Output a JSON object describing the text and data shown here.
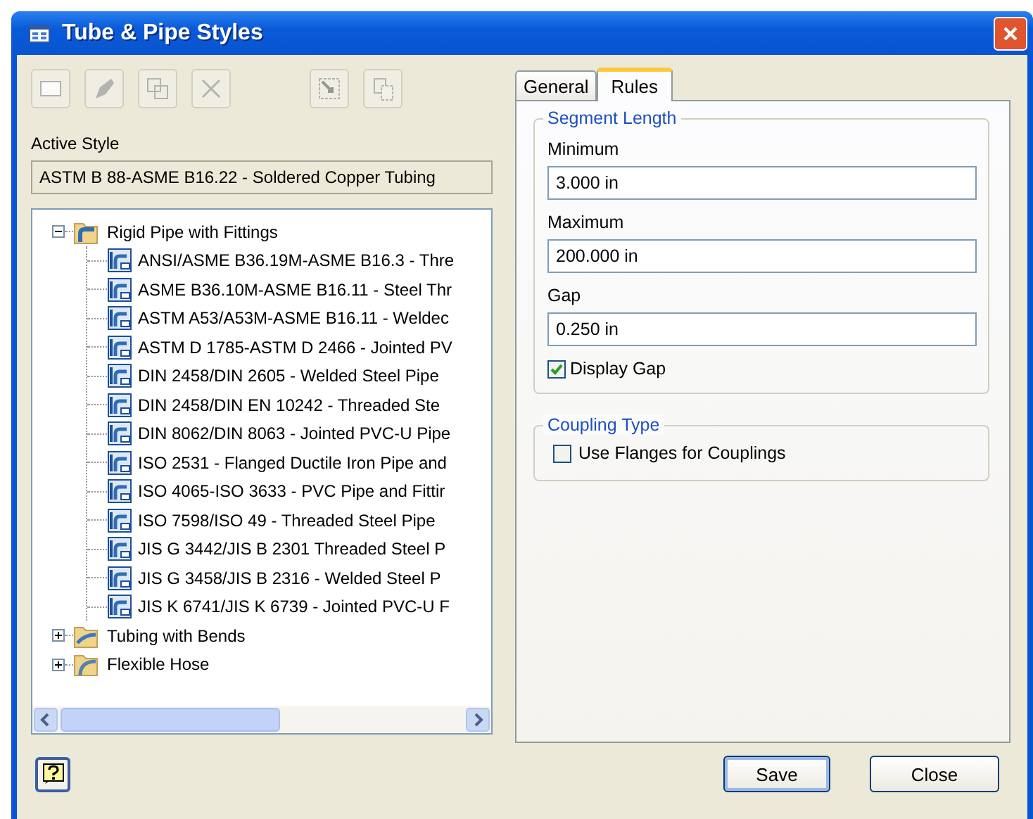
{
  "window": {
    "title": "Tube & Pipe Styles"
  },
  "toolbar": [
    {
      "kind": "new",
      "disabled": true
    },
    {
      "kind": "edit",
      "disabled": true
    },
    {
      "kind": "copy",
      "disabled": true
    },
    {
      "kind": "delete",
      "disabled": true
    },
    {
      "kind": "import",
      "disabled": true
    },
    {
      "kind": "export",
      "disabled": true
    }
  ],
  "active_style": {
    "label": "Active Style",
    "value": "ASTM B 88-ASME B16.22 - Soldered Copper Tubing"
  },
  "style_tree": [
    {
      "label": "Rigid Pipe with Fittings",
      "kind": "rigid",
      "expanded": true,
      "children": [
        {
          "label": "ANSI/ASME B36.19M-ASME B16.3 - Thre"
        },
        {
          "label": "ASME B36.10M-ASME B16.11 - Steel Thr"
        },
        {
          "label": "ASTM A53/A53M-ASME B16.11 - Weldec"
        },
        {
          "label": "ASTM D 1785-ASTM D 2466 - Jointed PV"
        },
        {
          "label": "DIN 2458/DIN 2605 - Welded Steel Pipe"
        },
        {
          "label": "DIN 2458/DIN EN 10242 - Threaded Ste"
        },
        {
          "label": "DIN 8062/DIN 8063 - Jointed PVC-U Pipe"
        },
        {
          "label": "ISO 2531 - Flanged Ductile Iron Pipe and"
        },
        {
          "label": "ISO 4065-ISO 3633 - PVC Pipe and Fittir"
        },
        {
          "label": "ISO 7598/ISO 49 - Threaded Steel Pipe"
        },
        {
          "label": "JIS G 3442/JIS B 2301 Threaded Steel P"
        },
        {
          "label": "JIS G 3458/JIS B 2316 -  Welded Steel P"
        },
        {
          "label": "JIS K 6741/JIS K 6739 - Jointed PVC-U F"
        }
      ]
    },
    {
      "label": "Tubing with Bends",
      "kind": "tubing",
      "expanded": false
    },
    {
      "label": "Flexible Hose",
      "kind": "hose",
      "expanded": false
    }
  ],
  "tabs": [
    {
      "label": "General",
      "selected": false
    },
    {
      "label": "Rules",
      "selected": true
    }
  ],
  "segment_length": {
    "title": "Segment Length",
    "fields": [
      {
        "label": "Minimum",
        "value": "3.000 in"
      },
      {
        "label": "Maximum",
        "value": "200.000 in"
      },
      {
        "label": "Gap",
        "value": "0.250 in"
      }
    ],
    "display_gap": {
      "label": "Display Gap",
      "checked": true
    }
  },
  "coupling_type": {
    "title": "Coupling Type",
    "use_flanges": {
      "label": "Use Flanges for Couplings",
      "checked": false
    }
  },
  "buttons": [
    {
      "label": "Save",
      "default": true
    },
    {
      "label": "Close",
      "default": false
    }
  ]
}
